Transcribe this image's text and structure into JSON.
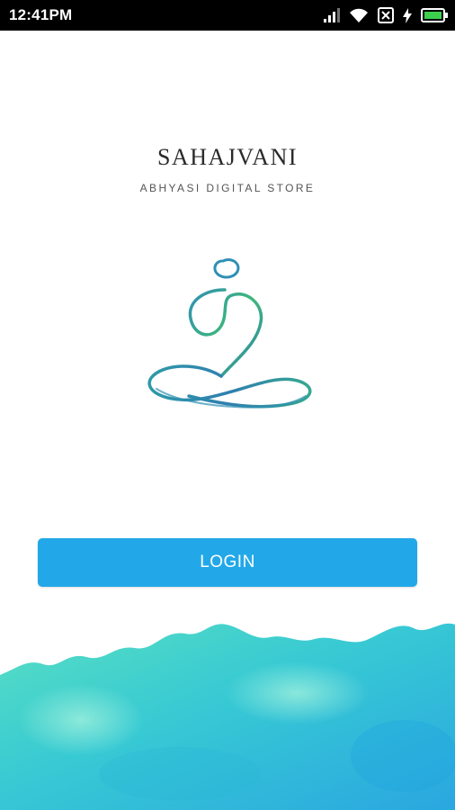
{
  "status_bar": {
    "time": "12:41PM",
    "icons": [
      "signal-icon",
      "wifi-icon",
      "no-sim-icon",
      "charging-bolt-icon",
      "battery-icon"
    ]
  },
  "brand": {
    "title": "SAHAJVANI",
    "subtitle": "ABHYASI DIGITAL STORE"
  },
  "login_button": {
    "label": "LOGIN"
  },
  "colors": {
    "button": "#22a8e8",
    "logo_teal": "#2f8fb5",
    "logo_green": "#3db87a",
    "watercolor_cyan": "#2ec4d6",
    "watercolor_mint": "#5fe0c0"
  }
}
